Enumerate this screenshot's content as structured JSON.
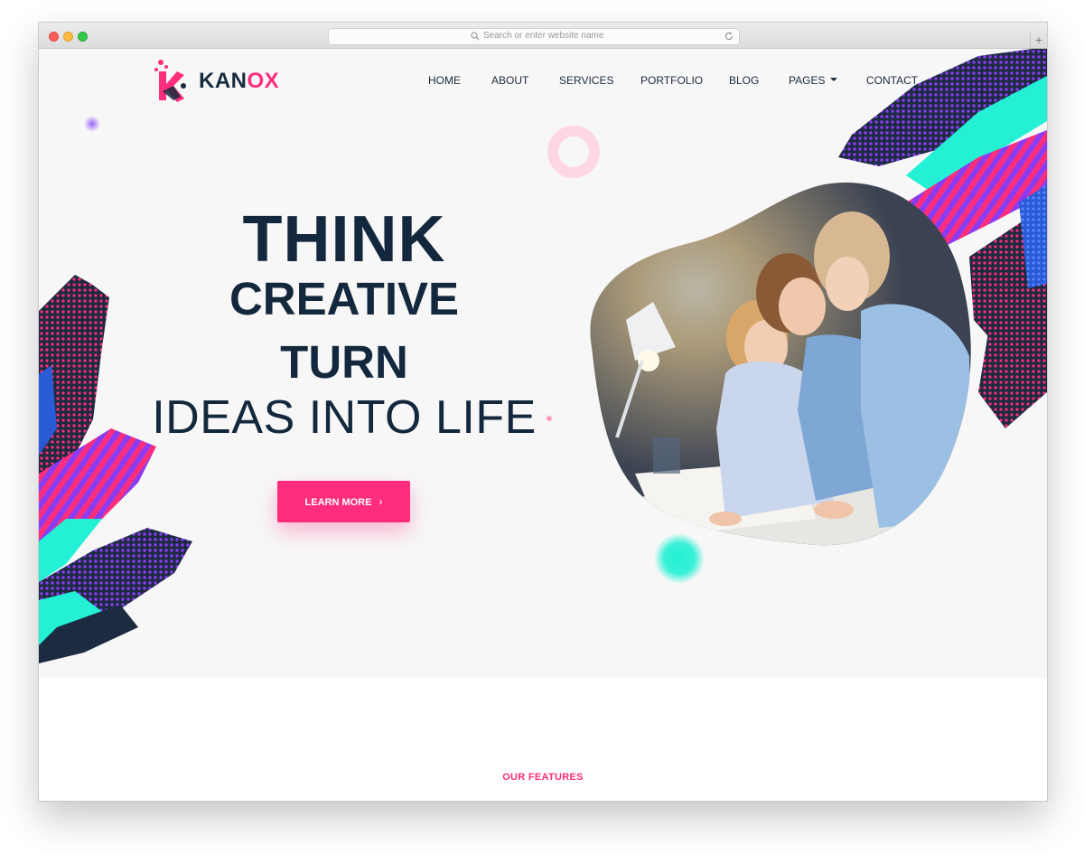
{
  "browser": {
    "address_placeholder": "Search or enter website name"
  },
  "brand": {
    "name_part1": "KAN",
    "name_part2": "OX",
    "accent_color": "#ff2d7b",
    "dark_color": "#13283d"
  },
  "nav": {
    "items": [
      {
        "label": "HOME"
      },
      {
        "label": "ABOUT"
      },
      {
        "label": "SERVICES"
      },
      {
        "label": "PORTFOLIO"
      },
      {
        "label": "BLOG"
      },
      {
        "label": "PAGES"
      },
      {
        "label": "CONTACT"
      }
    ],
    "dropdown_icon": "caret-down-icon"
  },
  "hero": {
    "line1": "THINK",
    "line2": "CREATIVE",
    "line3": "TURN",
    "line4": "IDEAS INTO LIFE",
    "cta_label": "LEARN MORE",
    "cta_icon": "chevron-right-icon"
  },
  "features": {
    "eyebrow": "OUR FEATURES"
  }
}
